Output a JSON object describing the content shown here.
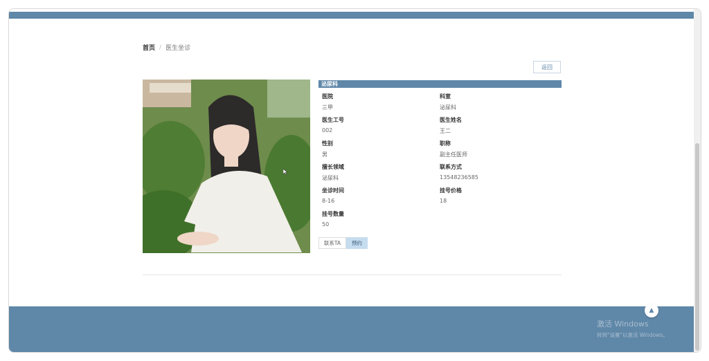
{
  "breadcrumb": {
    "home": "首页",
    "separator": "/",
    "current": "医生坐诊"
  },
  "back_button": "返回",
  "department_header": "泌尿科",
  "fields": [
    {
      "label": "医院",
      "value": "三甲"
    },
    {
      "label": "科室",
      "value": "泌尿科"
    },
    {
      "label": "医生工号",
      "value": "002"
    },
    {
      "label": "医生姓名",
      "value": "王二"
    },
    {
      "label": "性别",
      "value": "男"
    },
    {
      "label": "职称",
      "value": "副主任医师"
    },
    {
      "label": "擅长领域",
      "value": "泌尿科"
    },
    {
      "label": "联系方式",
      "value": "13548236585"
    },
    {
      "label": "坐诊时间",
      "value": "8-16"
    },
    {
      "label": "挂号价格",
      "value": "18"
    },
    {
      "label": "挂号数量",
      "value": "50"
    }
  ],
  "actions": {
    "contact": "联系TA",
    "book": "预约"
  },
  "scroll_top_icon": "▲",
  "watermark": {
    "line1": "激活 Windows",
    "line2": "转到\"设置\"以激活 Windows。"
  },
  "colors": {
    "primary": "#5f87a8",
    "book_button": "#c6dcef"
  }
}
